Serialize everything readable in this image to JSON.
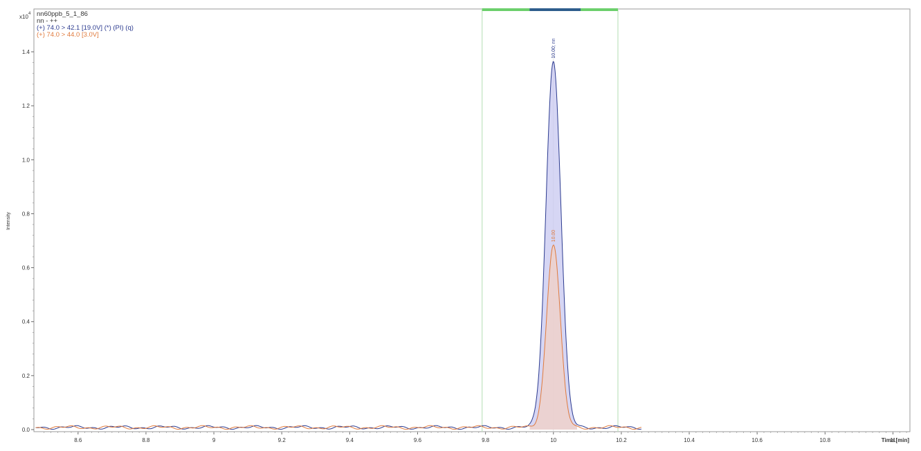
{
  "chart_data": {
    "type": "line",
    "sample_name": "nn60ppb_5_1_86",
    "compound_line": "nn - ++",
    "y_exponent_label": "x10",
    "y_exponent_power": "4",
    "ylabel": "Intensity",
    "xlabel": "Time [min]",
    "xlim": [
      8.47,
      11.05
    ],
    "ylim": [
      -0.01,
      1.5
    ],
    "x_ticks": [
      8.6,
      8.8,
      9,
      9.2,
      9.4,
      9.6,
      9.8,
      10,
      10.2,
      10.4,
      10.6,
      10.8,
      11
    ],
    "x_tick_labels": [
      "8.6",
      "8.8",
      "9",
      "9.2",
      "9.4",
      "9.6",
      "9.8",
      "10",
      "10.2",
      "10.4",
      "10.6",
      "10.8",
      "11"
    ],
    "y_ticks": [
      0.0,
      0.2,
      0.4,
      0.6,
      0.8,
      1.0,
      1.2,
      1.4
    ],
    "y_tick_labels": [
      "0.0",
      "0.2",
      "0.4",
      "0.6",
      "0.8",
      "1.0",
      "1.2",
      "1.4"
    ],
    "integration_window": [
      9.79,
      10.19
    ],
    "peak_window": [
      9.93,
      10.08
    ],
    "series": [
      {
        "name": "(+) 74.0 > 42.1 [19.0V] (*) (PI) (q)",
        "color": "#2b3a8f",
        "fill": "#c8c8f0",
        "peak_x": 10.0,
        "peak_y": 1.36,
        "sigma": 0.022,
        "peak_label": "10.00; nn",
        "x_end": 10.26
      },
      {
        "name": "(+) 74.0 > 44.0 [3.0V]",
        "color": "#e07a3c",
        "fill": "#f1d0c6",
        "peak_x": 10.0,
        "peak_y": 0.68,
        "sigma": 0.02,
        "peak_label": "10.00",
        "x_end": 10.26
      }
    ],
    "colors": {
      "integration_bar": "#6ccf6c",
      "peak_bar": "#2e5d8c",
      "window_line": "#bfe3bf"
    }
  }
}
